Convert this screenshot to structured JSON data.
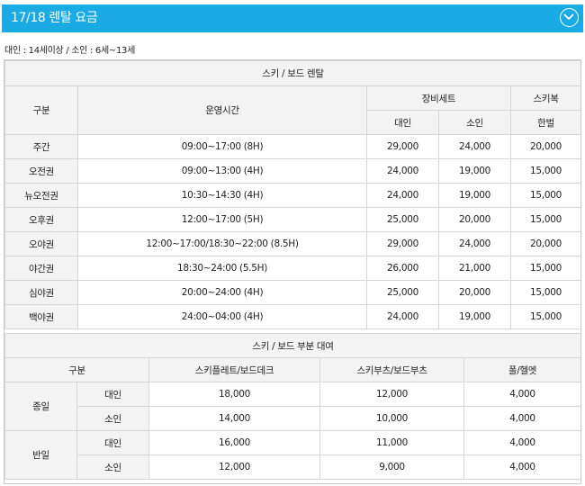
{
  "header": {
    "title": "17/18 렌탈 요금"
  },
  "note": "대인 : 14세이상 / 소인 : 6세~13세",
  "rental": {
    "title": "스키 / 보드 렌탈",
    "col_category": "구분",
    "col_hours": "운영시간",
    "col_equipment_set": "장비세트",
    "col_adult": "대인",
    "col_child": "소인",
    "col_ski_suit": "스키복",
    "col_one_set": "한벌",
    "rows": [
      {
        "name": "주간",
        "hours": "09:00~17:00 (8H)",
        "adult": "29,000",
        "child": "24,000",
        "suit": "20,000"
      },
      {
        "name": "오전권",
        "hours": "09:00~13:00 (4H)",
        "adult": "24,000",
        "child": "19,000",
        "suit": "15,000"
      },
      {
        "name": "뉴오전권",
        "hours": "10:30~14:30 (4H)",
        "adult": "24,000",
        "child": "19,000",
        "suit": "15,000"
      },
      {
        "name": "오후권",
        "hours": "12:00~17:00 (5H)",
        "adult": "25,000",
        "child": "20,000",
        "suit": "15,000"
      },
      {
        "name": "오야권",
        "hours": "12:00~17:00/18:30~22:00 (8.5H)",
        "adult": "29,000",
        "child": "24,000",
        "suit": "20,000"
      },
      {
        "name": "야간권",
        "hours": "18:30~24:00 (5.5H)",
        "adult": "26,000",
        "child": "21,000",
        "suit": "15,000"
      },
      {
        "name": "심야권",
        "hours": "20:00~24:00 (4H)",
        "adult": "25,000",
        "child": "20,000",
        "suit": "15,000"
      },
      {
        "name": "백야권",
        "hours": "24:00~04:00 (4H)",
        "adult": "24,000",
        "child": "19,000",
        "suit": "15,000"
      }
    ]
  },
  "partial": {
    "title": "스키 / 보드 부분 대여",
    "col_category": "구분",
    "col_plate": "스키플레트/보드데크",
    "col_boots": "스키부츠/보드부츠",
    "col_poles": "폴/헬멧",
    "groups": [
      {
        "name": "종일",
        "rows": [
          {
            "type": "대인",
            "plate": "18,000",
            "boots": "12,000",
            "poles": "4,000"
          },
          {
            "type": "소인",
            "plate": "14,000",
            "boots": "10,000",
            "poles": "4,000"
          }
        ]
      },
      {
        "name": "반일",
        "rows": [
          {
            "type": "대인",
            "plate": "16,000",
            "boots": "11,000",
            "poles": "4,000"
          },
          {
            "type": "소인",
            "plate": "12,000",
            "boots": "9,000",
            "poles": "4,000"
          }
        ]
      }
    ]
  },
  "icons": {
    "toggle": "chevron-down-circle-icon"
  },
  "colors": {
    "header_bg": "#1aabe4",
    "header_text": "#ffffff",
    "table_header_bg": "#f3f3f3",
    "border": "#d6d6d6"
  }
}
